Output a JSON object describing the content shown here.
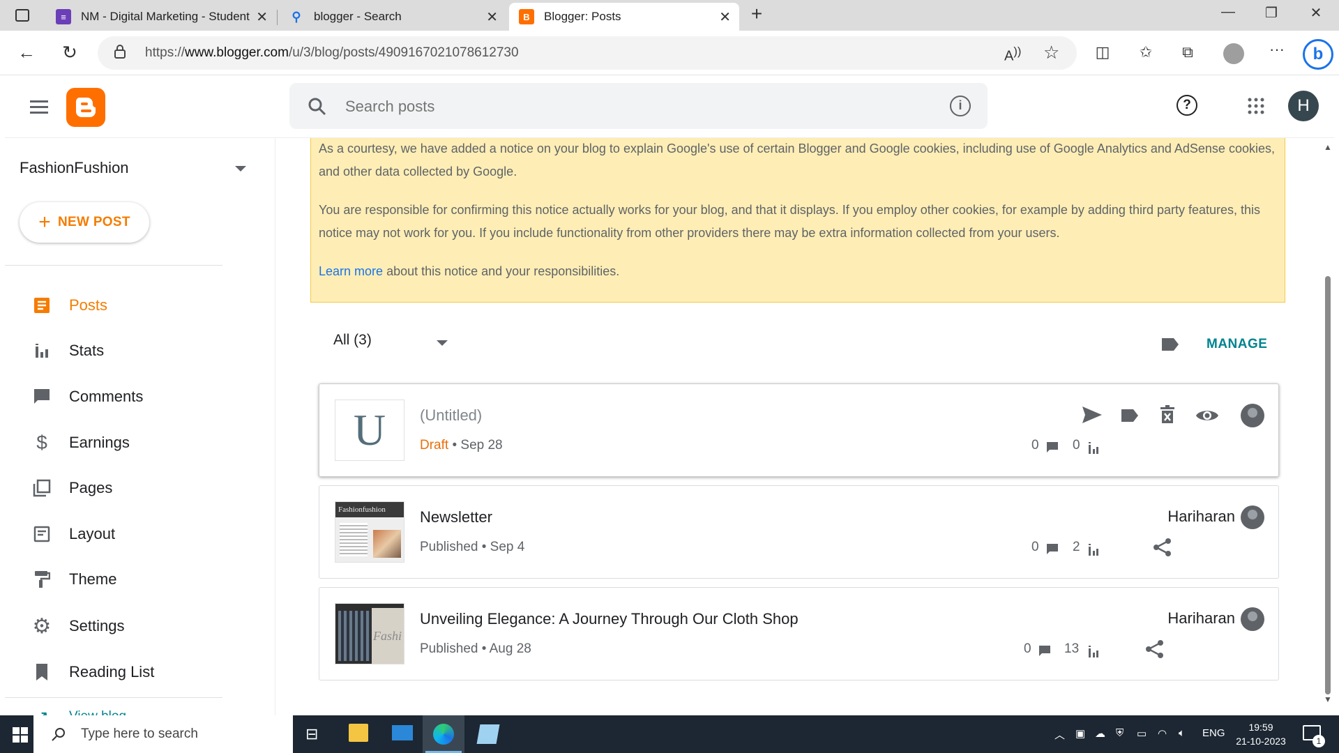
{
  "browser": {
    "tabs": [
      {
        "title": "NM - Digital Marketing - Student"
      },
      {
        "title": "blogger - Search"
      },
      {
        "title": "Blogger: Posts"
      }
    ],
    "url_prefix": "https://",
    "url_host": "www.blogger.com",
    "url_path": "/u/3/blog/posts/4909167021078612730"
  },
  "header": {
    "search_placeholder": "Search posts",
    "avatar_letter": "H"
  },
  "sidebar": {
    "blog_name": "FashionFushion",
    "new_post_label": "NEW POST",
    "items": [
      {
        "label": "Posts"
      },
      {
        "label": "Stats"
      },
      {
        "label": "Comments"
      },
      {
        "label": "Earnings"
      },
      {
        "label": "Pages"
      },
      {
        "label": "Layout"
      },
      {
        "label": "Theme"
      },
      {
        "label": "Settings"
      },
      {
        "label": "Reading List"
      },
      {
        "label": "View blog"
      }
    ]
  },
  "notice": {
    "p1": "As a courtesy, we have added a notice on your blog to explain Google's use of certain Blogger and Google cookies, including use of Google Analytics and AdSense cookies, and other data collected by Google.",
    "p2": "You are responsible for confirming this notice actually works for your blog, and that it displays. If you employ other cookies, for example by adding third party features, this notice may not work for you. If you include functionality from other providers there may be extra information collected from your users.",
    "learn_more": "Learn more",
    "p3_rest": " about this notice and your responsibilities."
  },
  "posts_toolbar": {
    "filter_label": "All (3)",
    "manage_label": "MANAGE"
  },
  "posts": [
    {
      "title": "(Untitled)",
      "status": "Draft",
      "date": "• Sep 28",
      "thumb_letter": "U",
      "author": "",
      "comments": "0",
      "views": "0"
    },
    {
      "title": "Newsletter",
      "status": "Published",
      "date": "• Sep 4",
      "author": "Hariharan",
      "comments": "0",
      "views": "2",
      "thumb_text": "Fashionfushion"
    },
    {
      "title": "Unveiling Elegance: A Journey Through Our Cloth Shop",
      "status": "Published",
      "date": "• Aug 28",
      "author": "Hariharan",
      "comments": "0",
      "views": "13",
      "thumb_text": "Fashi"
    }
  ],
  "taskbar": {
    "search_placeholder": "Type here to search",
    "lang": "ENG",
    "time": "19:59",
    "date": "21-10-2023",
    "notif_count": "1"
  },
  "colors": {
    "accent": "#f57c00",
    "manage": "#00838f",
    "notice_bg": "#feeeb5",
    "link": "#1a73e8"
  }
}
